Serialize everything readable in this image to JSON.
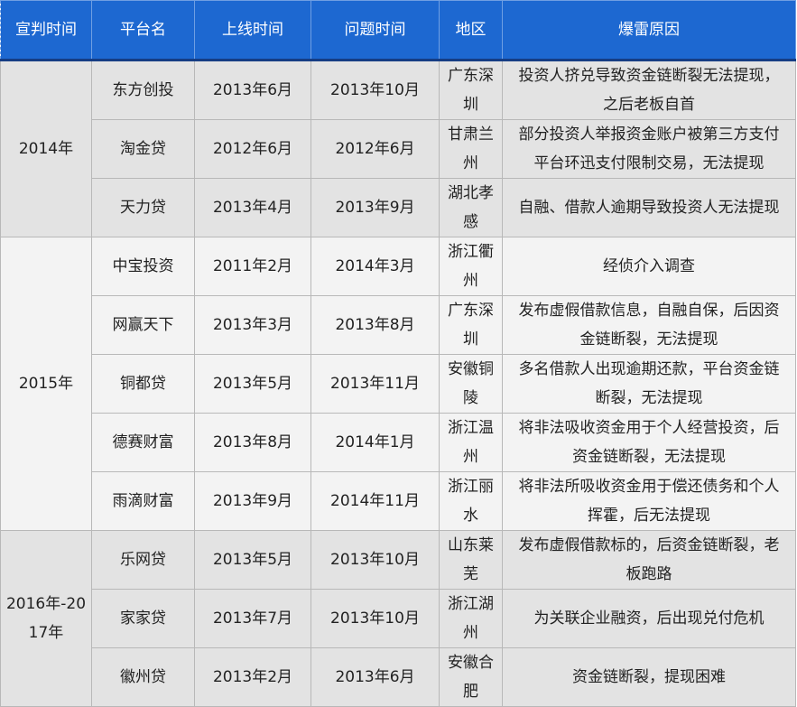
{
  "headers": {
    "verdict_time": "宣判时间",
    "platform": "平台名",
    "launch_time": "上线时间",
    "problem_time": "问题时间",
    "region": "地区",
    "reason": "爆雷原因"
  },
  "groups": [
    {
      "year": "2014年",
      "rows": [
        {
          "platform": "东方创投",
          "launch": "2013年6月",
          "problem": "2013年10月",
          "region": "广东深圳",
          "reason": "投资人挤兑导致资金链断裂无法提现，之后老板自首"
        },
        {
          "platform": "淘金贷",
          "launch": "2012年6月",
          "problem": "2012年6月",
          "region": "甘肃兰州",
          "reason": "部分投资人举报资金账户被第三方支付平台环迅支付限制交易，无法提现"
        },
        {
          "platform": "天力贷",
          "launch": "2013年4月",
          "problem": "2013年9月",
          "region": "湖北孝感",
          "reason": "自融、借款人逾期导致投资人无法提现"
        }
      ]
    },
    {
      "year": "2015年",
      "rows": [
        {
          "platform": "中宝投资",
          "launch": "2011年2月",
          "problem": "2014年3月",
          "region": "浙江衢州",
          "reason": "经侦介入调查"
        },
        {
          "platform": "网赢天下",
          "launch": "2013年3月",
          "problem": "2013年8月",
          "region": "广东深圳",
          "reason": "发布虚假借款信息，自融自保，后因资金链断裂，无法提现"
        },
        {
          "platform": "铜都贷",
          "launch": "2013年5月",
          "problem": "2013年11月",
          "region": "安徽铜陵",
          "reason": "多名借款人出现逾期还款，平台资金链断裂，无法提现"
        },
        {
          "platform": "德赛财富",
          "launch": "2013年8月",
          "problem": "2014年1月",
          "region": "浙江温州",
          "reason": "将非法吸收资金用于个人经营投资，后资金链断裂，无法提现"
        },
        {
          "platform": "雨滴财富",
          "launch": "2013年9月",
          "problem": "2014年11月",
          "region": "浙江丽水",
          "reason": "将非法所吸收资金用于偿还债务和个人挥霍，后无法提现"
        }
      ]
    },
    {
      "year": "2016年-2017年",
      "rows": [
        {
          "platform": "乐网贷",
          "launch": "2013年5月",
          "problem": "2013年10月",
          "region": "山东莱芜",
          "reason": "发布虚假借款标的，后资金链断裂，老板跑路"
        },
        {
          "platform": "家家贷",
          "launch": "2013年7月",
          "problem": "2013年10月",
          "region": "浙江湖州",
          "reason": "为关联企业融资，后出现兑付危机"
        },
        {
          "platform": "徽州贷",
          "launch": "2013年2月",
          "problem": "2013年6月",
          "region": "安徽合肥",
          "reason": "资金链断裂，提现困难"
        }
      ]
    }
  ]
}
